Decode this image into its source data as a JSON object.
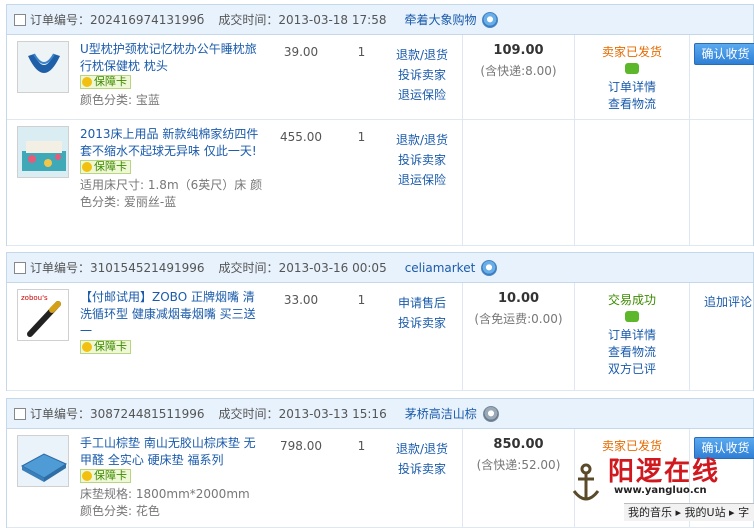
{
  "labels": {
    "order_no": "订单编号：",
    "deal_time": "成交时间：",
    "card_badge": "保障卡"
  },
  "orders": [
    {
      "number": "20241697413199б",
      "time": "2013-03-18 17:58",
      "shop": "牵着大象购物",
      "total": "109.00",
      "shipping": "(含快递:8.00)",
      "status": "卖家已发货",
      "status_links": [
        "订单详情",
        "查看物流"
      ],
      "action": "确认收货",
      "items": [
        {
          "title": "U型枕护颈枕记忆枕办公午睡枕旅行枕保健枕 枕头",
          "attrs": [
            "颜色分类: 宝蓝"
          ],
          "price": "39.00",
          "qty": "1",
          "ops": [
            "退款/退货",
            "投诉卖家",
            "退运保险"
          ]
        },
        {
          "title": "2013床上用品 新款纯棉家纺四件套不缩水不起球无异味 仅此一天!",
          "attrs": [
            "适用床尺寸: 1.8m（6英尺）床 颜色分类: 爱丽丝-蓝"
          ],
          "price": "455.00",
          "qty": "1",
          "ops": [
            "退款/退货",
            "投诉卖家",
            "退运保险"
          ]
        }
      ]
    },
    {
      "number": "310154521491996",
      "time": "2013-03-16 00:05",
      "shop": "celiamarket",
      "total": "10.00",
      "shipping": "(含免运费:0.00)",
      "status": "交易成功",
      "status_links": [
        "订单详情",
        "查看物流",
        "双方已评"
      ],
      "action": "追加评论",
      "items": [
        {
          "title": "【付邮试用】ZOBO 正牌烟嘴 清洗循环型 健康减烟毒烟嘴 买三送一",
          "attrs": [],
          "price": "33.00",
          "qty": "1",
          "ops": [
            "申请售后",
            "投诉卖家"
          ]
        }
      ]
    },
    {
      "number": "308724481511996",
      "time": "2013-03-13 15:16",
      "shop": "茅桥高洁山棕",
      "total": "850.00",
      "shipping": "(含快递:52.00)",
      "status": "卖家已发货",
      "status_links": [],
      "action": "确认收货",
      "items": [
        {
          "title": "手工山棕垫 南山无胶山棕床垫 无甲醛 全实心 硬床垫 福系列",
          "attrs": [
            "床垫规格: 1800mm*2000mm 颜色分类: 花色"
          ],
          "price": "798.00",
          "qty": "1",
          "ops": [
            "退款/退货",
            "投诉卖家"
          ]
        }
      ]
    }
  ],
  "watermark": {
    "cn": "阳逻在线",
    "url": "www.yangluo.cn",
    "bar": "我的音乐 ▸ 我的U站 ▸ 字"
  },
  "colors": {
    "link": "#1a5bab",
    "status_shipped": "#e56b00",
    "status_success": "#3d8a00",
    "header_bg": "#e8f2fc",
    "button": "#2f7fd6"
  }
}
